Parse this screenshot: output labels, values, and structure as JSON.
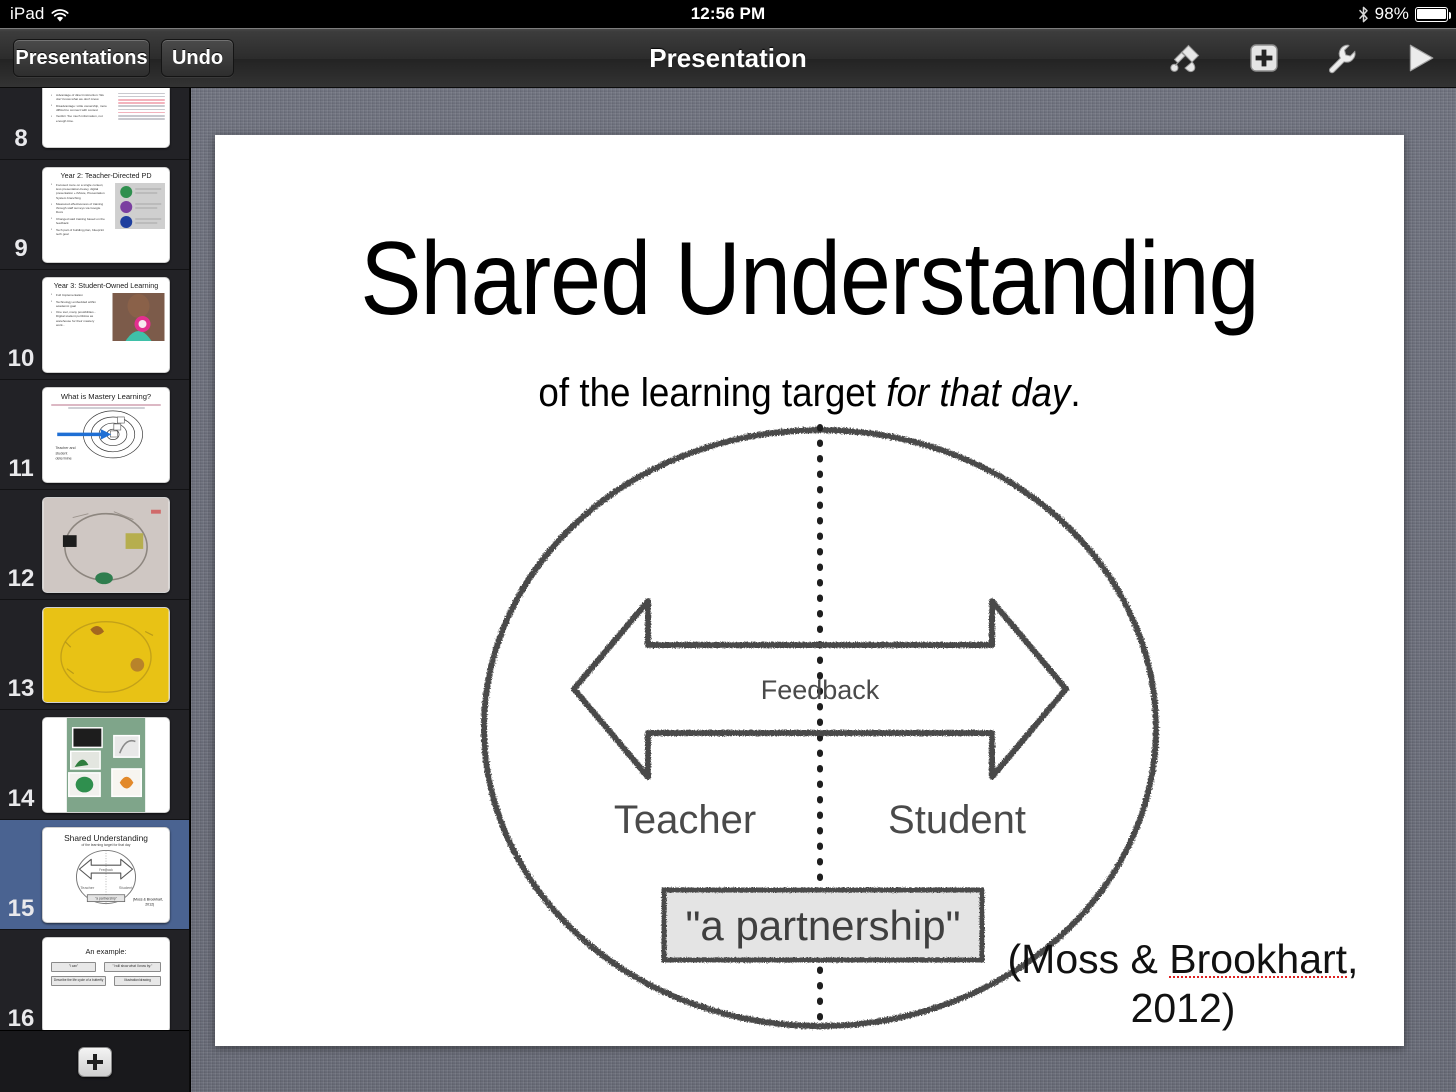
{
  "statusbar": {
    "device": "iPad",
    "wifi_icon": "wifi-icon",
    "time": "12:56 PM",
    "bluetooth_icon": "bluetooth-icon",
    "battery_percent": "98%",
    "battery_icon": "battery-icon"
  },
  "toolbar": {
    "presentations_label": "Presentations",
    "undo_label": "Undo",
    "title": "Presentation",
    "tools": [
      {
        "name": "paintbrush-icon",
        "label": "Format"
      },
      {
        "name": "plus-box-icon",
        "label": "Insert"
      },
      {
        "name": "wrench-icon",
        "label": "Tools"
      },
      {
        "name": "play-icon",
        "label": "Play"
      }
    ]
  },
  "sidebar": {
    "add_slide_icon": "plus-icon",
    "selected_slide": 15,
    "slides": [
      {
        "number": "8",
        "kind": "bullets-image",
        "cut_off": true,
        "bullets": [
          "Advantage of direct instruction: We don't know what we don't know.",
          "Disadvantage: Little ownership, more difficult to connect with context",
          "Verdict: Too much information, not enough time."
        ]
      },
      {
        "number": "9",
        "kind": "title-bullets-image",
        "title": "Year 2: Teacher-Directed PD",
        "bullets": [
          "Focused more on a single context, less presentation-heavy, digital presentation + iMovie, Presentation System branching",
          "Measured effectiveness of training through staff surveys via Google Docs",
          "Changed said training based on the feedback",
          "Tech part of building plan, blueprint tech goal"
        ]
      },
      {
        "number": "10",
        "kind": "title-bullets-photo",
        "title": "Year 3: Student-Owned Learning",
        "bullets": [
          "Full Implementation",
          "Technology embedded within academic goal",
          "One tool, many possibilities - Digital student portfolios as warehouse for their mastery work..."
        ]
      },
      {
        "number": "11",
        "kind": "mastery-diagram",
        "title": "What is Mastery Learning?",
        "caption": "Teacher and student determine mastery together"
      },
      {
        "number": "12",
        "kind": "photo-whiteboard"
      },
      {
        "number": "13",
        "kind": "photo-yellow"
      },
      {
        "number": "14",
        "kind": "photo-bulletin"
      },
      {
        "number": "15",
        "kind": "shared-understanding",
        "title": "Shared Understanding",
        "subtitle": "of the learning target for that day",
        "labels": [
          "Feedback",
          "Teacher",
          "Student",
          "\"a partnership\""
        ],
        "citation": "(Moss & Brookhart, 2012)"
      },
      {
        "number": "16",
        "kind": "example-boxes",
        "title": "An example:",
        "boxes": [
          "\"I can\"",
          "\"I will show what I know by:\"",
          "Describe the life cycle of a butterfly",
          "Illustration/drawing"
        ]
      }
    ]
  },
  "slide": {
    "title": "Shared Understanding",
    "subtitle_plain": "of the learning target ",
    "subtitle_italic": "for that day",
    "subtitle_end": ".",
    "diagram": {
      "feedback_label": "Feedback",
      "teacher_label": "Teacher",
      "student_label": "Student",
      "partnership_label": "\"a partnership\""
    },
    "citation_line1_pre": "(Moss & ",
    "citation_line1_misspelled": "Brookhart",
    "citation_line1_post": ",",
    "citation_line2": "2012)"
  },
  "colors": {
    "selection_blue": "#4a6391",
    "canvas_gray": "#6d707c",
    "sketch_gray": "#4a4a4a",
    "spellcheck_red": "#e02020"
  }
}
